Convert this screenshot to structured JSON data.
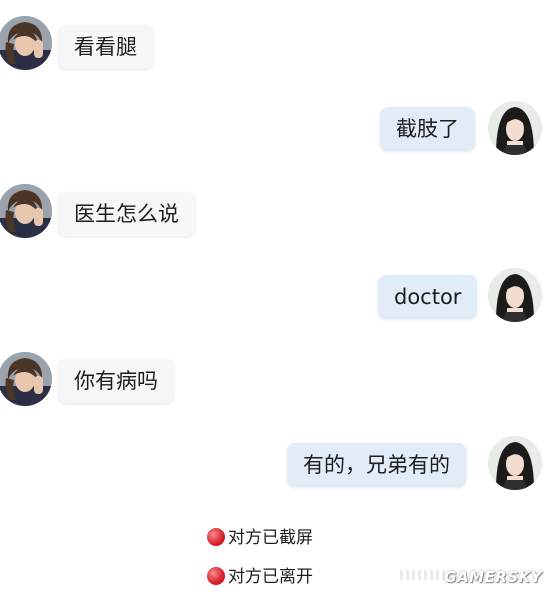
{
  "messages": [
    {
      "side": "left",
      "text": "看看腿"
    },
    {
      "side": "right",
      "text": "截肢了"
    },
    {
      "side": "left",
      "text": "医生怎么说"
    },
    {
      "side": "right",
      "text": "doctor"
    },
    {
      "side": "left",
      "text": "你有病吗"
    },
    {
      "side": "right",
      "text": "有的，兄弟有的"
    }
  ],
  "notices": [
    {
      "text": "对方已截屏"
    },
    {
      "text": "对方已离开"
    }
  ],
  "watermark": "GAMERSKY",
  "colors": {
    "left_bubble": "#f7f7f7",
    "right_bubble": "#e2ecf9",
    "notice_dot": "#d81e2a"
  }
}
